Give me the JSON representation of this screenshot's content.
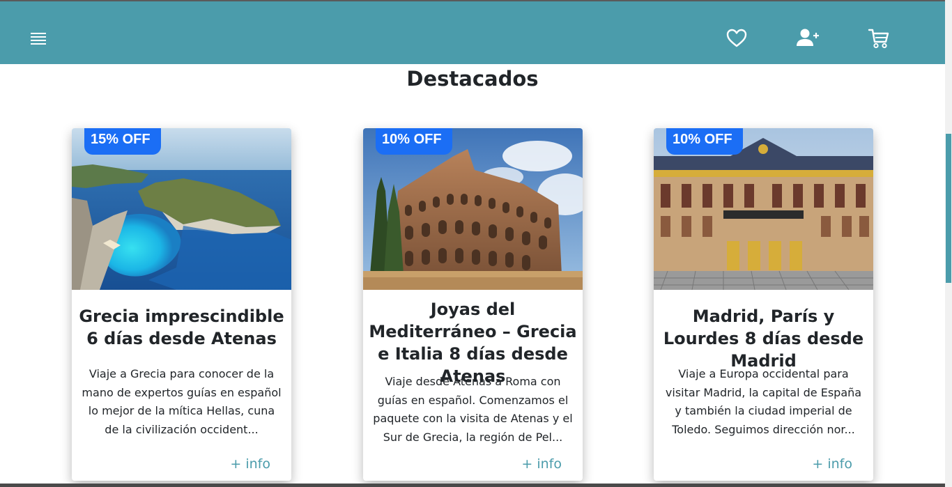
{
  "header": {
    "menu_icon": "hamburger-menu-icon",
    "favorites_icon": "heart-icon",
    "register_icon": "user-plus-icon",
    "cart_icon": "shopping-cart-icon",
    "colors": {
      "bar": "#4b9cab",
      "icons": "#ffffff"
    }
  },
  "section": {
    "title": "Destacados"
  },
  "cards": [
    {
      "badge": "15% OFF",
      "title": "Grecia imprescindible 6 días desde Atenas",
      "description": "Viaje a Grecia para conocer de la mano de expertos guías en español lo mejor de la mítica Hellas, cuna de la civilización occident...",
      "link": "+ info",
      "image": "greek-coast-beach-photo"
    },
    {
      "badge": "10% OFF",
      "title": "Joyas del Mediterráneo – Grecia e Italia 8 días desde Atenas",
      "description": "Viaje desde Atenas a Roma con guías en español. Comenzamos el paquete con la visita de Atenas y el Sur de Grecia, la región de Pel...",
      "link": "+ info",
      "image": "roman-colosseum-photo"
    },
    {
      "badge": "10% OFF",
      "title": "Madrid, París y Lourdes 8 días desde Madrid",
      "description": "Viaje a Europa occidental para visitar Madrid, la capital de España y también la ciudad imperial de Toledo. Seguimos dirección nor...",
      "link": "+ info",
      "image": "versailles-palace-photo"
    }
  ],
  "colors": {
    "accent": "#4b9cab",
    "badge": "#1b6ef5",
    "text": "#212529"
  }
}
